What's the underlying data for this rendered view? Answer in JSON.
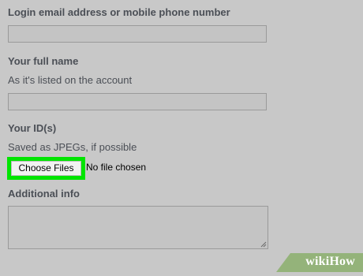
{
  "form": {
    "login_label": "Login email address or mobile phone number",
    "name_label": "Your full name",
    "name_hint": "As it's listed on the account",
    "id_label": "Your ID(s)",
    "id_hint": "Saved as JPEGs, if possible",
    "choose_files_label": "Choose Files",
    "file_status": "No file chosen",
    "additional_label": "Additional info"
  },
  "watermark": {
    "prefix": "wiki",
    "suffix": "How"
  },
  "colors": {
    "highlight": "#00e500",
    "background": "#c8c8c8",
    "watermark_bg": "#94b37a"
  }
}
